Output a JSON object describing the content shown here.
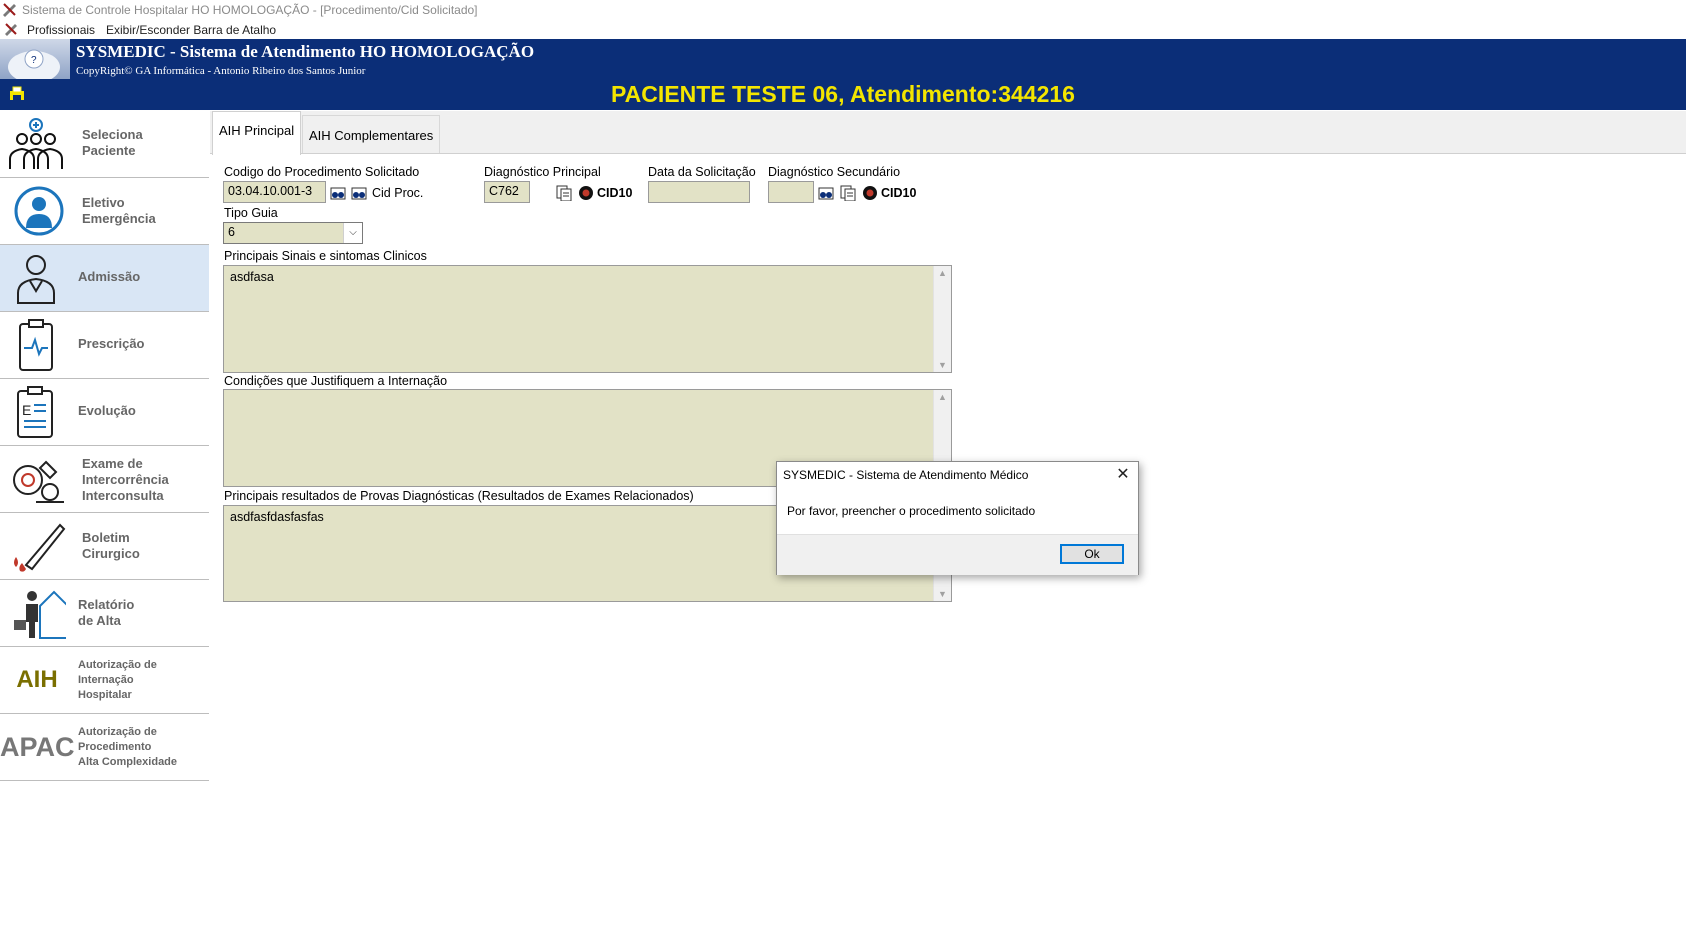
{
  "window": {
    "title": "Sistema de Controle Hospitalar HO HOMOLOGAÇÃO - [Procedimento/Cid Solicitado]"
  },
  "menu": {
    "items": [
      "Profissionais",
      "Exibir/Esconder Barra de Atalho"
    ]
  },
  "header": {
    "title": "SYSMEDIC - Sistema de Atendimento HO HOMOLOGAÇÃO",
    "copyright": "CopyRight© GA Informática - Antonio Ribeiro dos Santos Junior",
    "patient": "PACIENTE TESTE 06, Atendimento:344216"
  },
  "sidebar": {
    "items": [
      {
        "label": "Seleciona\nPaciente",
        "icon": "team-icon"
      },
      {
        "label": "Eletivo\nEmergência",
        "icon": "doctor-circle-icon"
      },
      {
        "label": "Admissão",
        "icon": "doctor-icon"
      },
      {
        "label": "Prescrição",
        "icon": "clipboard-pulse-icon"
      },
      {
        "label": "Evolução",
        "icon": "clipboard-chart-icon"
      },
      {
        "label": "Exame de\nIntercorrência\nInterconsulta",
        "icon": "microscope-icon"
      },
      {
        "label": "Boletim\nCirurgico",
        "icon": "scalpel-icon"
      },
      {
        "label": "Relatório\nde Alta",
        "icon": "discharge-icon"
      },
      {
        "label": "Autorização de\nInternação\nHospitalar",
        "badge": "AIH"
      },
      {
        "label": "Autorização de\nProcedimento\nAlta Complexidade",
        "badge": "APAC"
      }
    ],
    "active_index": 2
  },
  "tabs": [
    "AIH Principal",
    "AIH Complementares"
  ],
  "form": {
    "procedimento_label": "Codigo do Procedimento Solicitado",
    "procedimento_value": "03.04.10.001-3",
    "cid_proc_label": "Cid Proc.",
    "diag_principal_label": "Diagnóstico Principal",
    "diag_principal_value": "C762",
    "cid10_label": "CID10",
    "data_solicitacao_label": "Data da Solicitação",
    "data_solicitacao_value": "",
    "diag_secundario_label": "Diagnóstico Secundário",
    "diag_secundario_value": "",
    "tipo_guia_label": "Tipo Guia",
    "tipo_guia_value": "6",
    "sinais_label": "Principais Sinais e sintomas Clinicos",
    "sinais_value": "asdfasa",
    "condicoes_label": "Condições que Justifiquem a Internação",
    "condicoes_value": "",
    "resultados_label": "Principais resultados de Provas Diagnósticas (Resultados de Exames Relacionados)",
    "resultados_value": "asdfasfdasfasfas"
  },
  "dialog": {
    "title": "SYSMEDIC - Sistema de Atendimento Médico",
    "message": "Por favor, preencher o procedimento solicitado",
    "ok_label": "Ok",
    "close_glyph": "✕"
  },
  "colors": {
    "header_blue": "#0b2e78",
    "patient_yellow": "#f3e500",
    "field_bg": "#e2e2c6",
    "active_sidebar": "#d9e6f5"
  }
}
